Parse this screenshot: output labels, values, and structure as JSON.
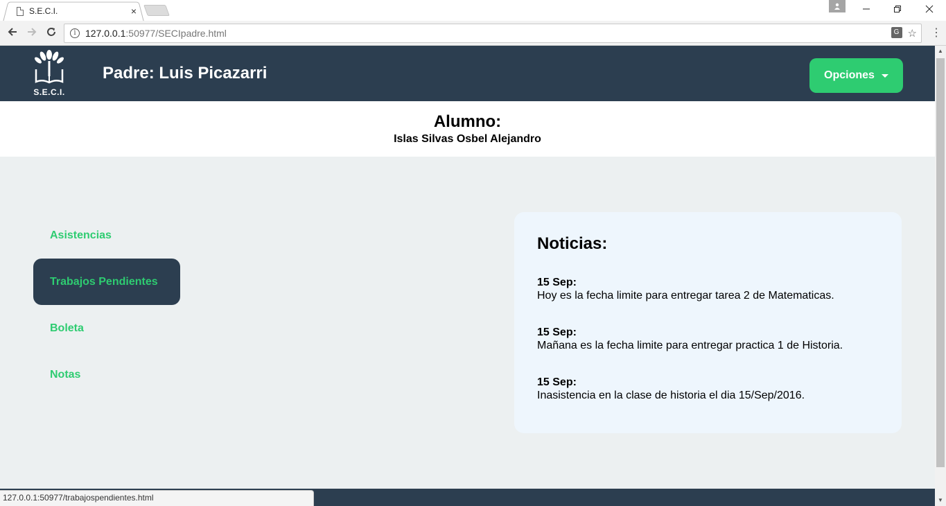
{
  "browser": {
    "tab_title": "S.E.C.I.",
    "tab_close": "×",
    "url_host": "127.0.0.1",
    "url_rest": ":50977/SECIpadre.html",
    "status_url": "127.0.0.1:50977/trabajospendientes.html"
  },
  "header": {
    "logo_text": "S.E.C.I.",
    "title": "Padre: Luis Picazarri",
    "options_label": "Opciones"
  },
  "student": {
    "label": "Alumno:",
    "name": "Islas Silvas Osbel Alejandro"
  },
  "menu": {
    "items": [
      {
        "label": "Asistencias"
      },
      {
        "label": "Trabajos Pendientes"
      },
      {
        "label": "Boleta"
      },
      {
        "label": "Notas"
      }
    ]
  },
  "news": {
    "title": "Noticias:",
    "items": [
      {
        "date": "15 Sep:",
        "text": "Hoy es la fecha limite para entregar tarea 2 de Matematicas."
      },
      {
        "date": "15 Sep:",
        "text": "Mañana es la fecha limite para entregar practica 1 de Historia."
      },
      {
        "date": "15 Sep:",
        "text": "Inasistencia en la clase de historia el dia 15/Sep/2016."
      }
    ]
  },
  "colors": {
    "header_bg": "#2c3e50",
    "accent": "#2ecc71",
    "page_bg": "#ecf0f1",
    "news_bg": "#eef6fd"
  }
}
